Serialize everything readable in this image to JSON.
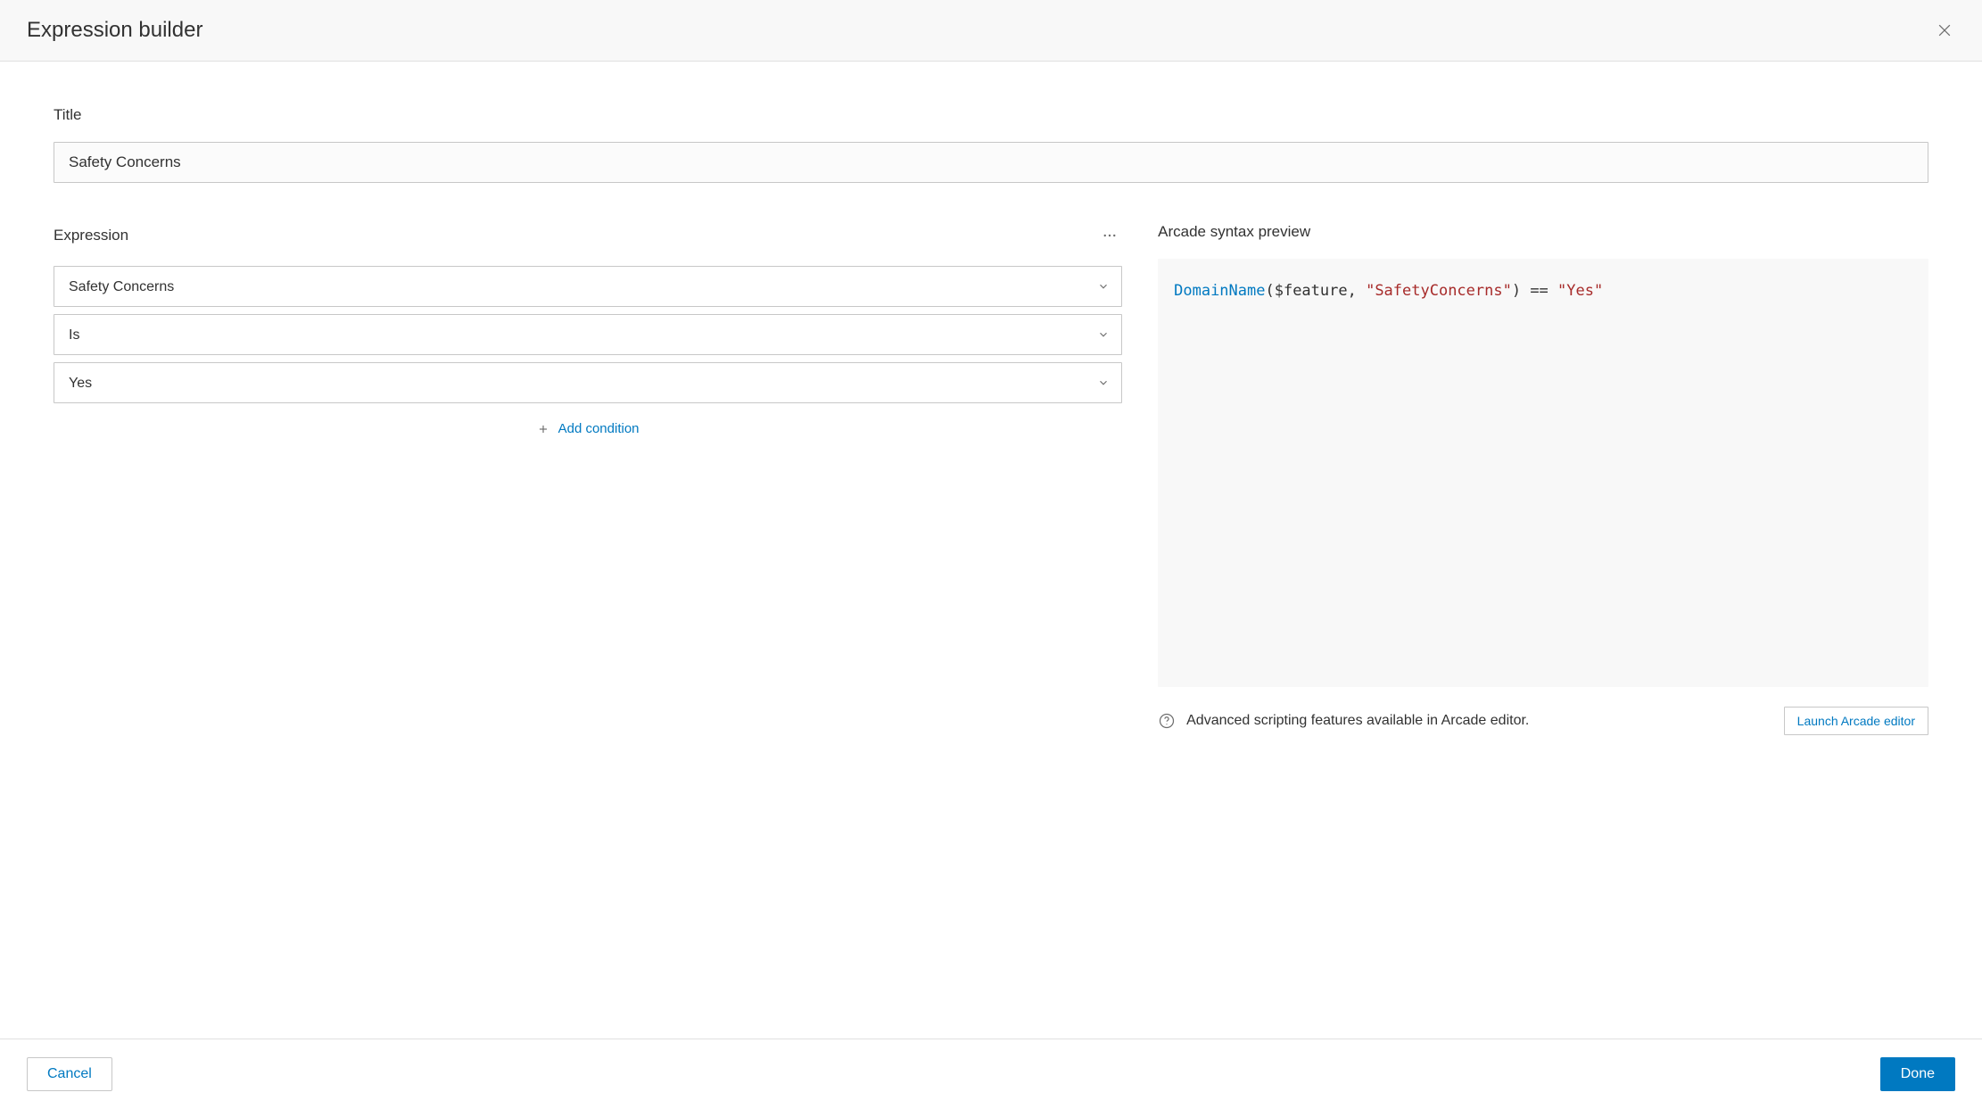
{
  "header": {
    "title": "Expression builder"
  },
  "title": {
    "label": "Title",
    "value": "Safety Concerns"
  },
  "expression": {
    "label": "Expression",
    "field_select": "Safety Concerns",
    "operator_select": "Is",
    "value_select": "Yes",
    "add_condition_label": "Add condition"
  },
  "preview": {
    "label": "Arcade syntax preview",
    "code": {
      "func": "DomainName",
      "open": "($feature, ",
      "arg_str": "\"SafetyConcerns\"",
      "close": ") == ",
      "val_str": "\"Yes\""
    },
    "info_text": "Advanced scripting features available in Arcade editor.",
    "launch_label": "Launch Arcade editor"
  },
  "footer": {
    "cancel_label": "Cancel",
    "done_label": "Done"
  }
}
